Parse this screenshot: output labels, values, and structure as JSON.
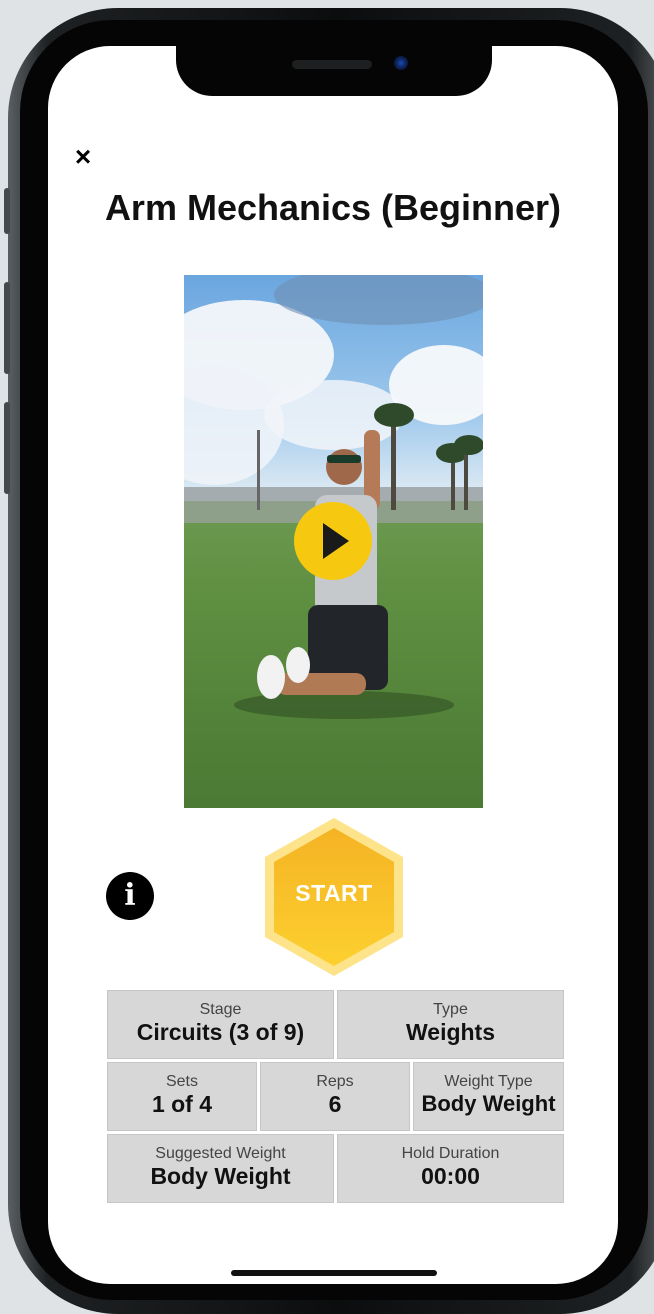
{
  "header": {
    "close_label": "×",
    "title": "Arm Mechanics (Beginner)"
  },
  "video": {
    "play_icon": "play-icon",
    "play_color": "#f6c910"
  },
  "actions": {
    "info_icon": "info-icon",
    "info_glyph": "i",
    "start_label": "START",
    "start_color": "#fbbf24"
  },
  "stats": {
    "stage": {
      "label": "Stage",
      "value": "Circuits (3 of 9)"
    },
    "type": {
      "label": "Type",
      "value": "Weights"
    },
    "sets": {
      "label": "Sets",
      "value": "1 of 4"
    },
    "reps": {
      "label": "Reps",
      "value": "6"
    },
    "weight_type": {
      "label": "Weight Type",
      "value": "Body Weight"
    },
    "suggested_weight": {
      "label": "Suggested Weight",
      "value": "Body Weight"
    },
    "hold_duration": {
      "label": "Hold Duration",
      "value": "00:00"
    }
  }
}
